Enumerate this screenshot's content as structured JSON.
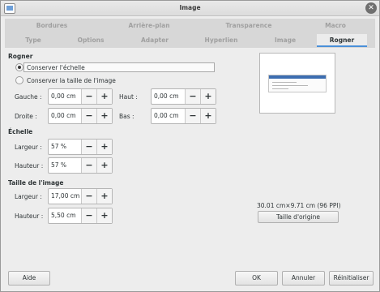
{
  "window": {
    "title": "Image"
  },
  "tabs": {
    "row1": [
      "Bordures",
      "Arrière-plan",
      "Transparence",
      "Macro"
    ],
    "row2": [
      "Type",
      "Options",
      "Adapter",
      "Hyperlien",
      "Image",
      "Rogner"
    ],
    "active": "Rogner"
  },
  "rogner": {
    "title": "Rogner",
    "options": [
      "Conserver l'échelle",
      "Conserver la taille de l'image"
    ],
    "selected": "Conserver l'échelle",
    "gauche": {
      "label": "Gauche :",
      "value": "0,00 cm"
    },
    "droite": {
      "label": "Droite :",
      "value": "0,00 cm"
    },
    "haut": {
      "label": "Haut :",
      "value": "0,00 cm"
    },
    "bas": {
      "label": "Bas :",
      "value": "0,00 cm"
    }
  },
  "echelle": {
    "title": "Échelle",
    "largeur": {
      "label": "Largeur :",
      "value": "57 %"
    },
    "hauteur": {
      "label": "Hauteur :",
      "value": "57 %"
    }
  },
  "taille": {
    "title": "Taille de l'image",
    "largeur": {
      "label": "Largeur :",
      "value": "17,00 cm"
    },
    "hauteur": {
      "label": "Hauteur :",
      "value": "5,50 cm"
    }
  },
  "spin": {
    "minus": "−",
    "plus": "+"
  },
  "preview": {
    "size_text": "30.01 cm×9.71 cm (96 PPI)",
    "original_size_button": "Taille d'origine"
  },
  "footer": {
    "help": "Aide",
    "ok": "OK",
    "cancel": "Annuler",
    "reset": "Réinitialiser"
  },
  "icons": {
    "close": "close-icon",
    "app": "app-icon"
  },
  "colors": {
    "active_tab_underline": "#4a90d9"
  }
}
